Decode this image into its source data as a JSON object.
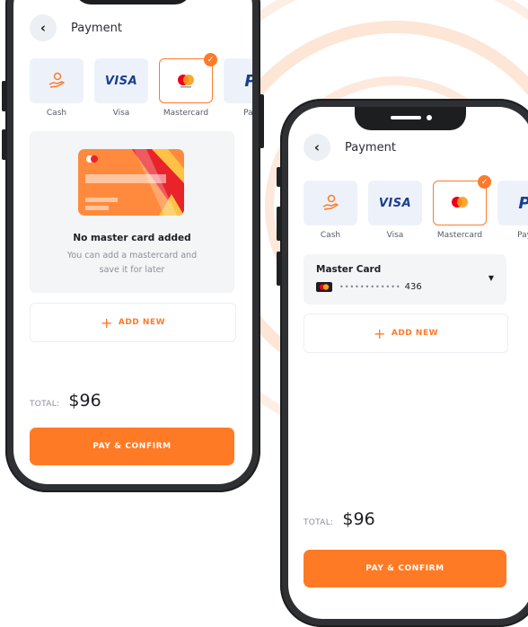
{
  "colors": {
    "accent": "#ff7a24",
    "tile_bg": "#edf2fa",
    "frame": "#2f3033"
  },
  "left_screen": {
    "header": {
      "back_icon": "chevron-left-icon",
      "back_glyph": "‹",
      "title": "Payment"
    },
    "methods": [
      {
        "label": "Cash",
        "icon": "cash-hand-icon",
        "selected": false
      },
      {
        "label": "Visa",
        "icon": "visa-logo",
        "logo_text": "VISA",
        "selected": false
      },
      {
        "label": "Mastercard",
        "icon": "mastercard-logo",
        "selected": true
      },
      {
        "label": "Pay",
        "icon": "paypal-logo",
        "logo_text": "P",
        "selected": false
      }
    ],
    "empty_state": {
      "title": "No master card added",
      "line1": "You can add a mastercard and",
      "line2": "save it for later"
    },
    "add_new": "ADD NEW",
    "total_label": "TOTAL:",
    "total_value": "$96",
    "pay_button": "PAY & CONFIRM"
  },
  "right_screen": {
    "header": {
      "back_icon": "chevron-left-icon",
      "back_glyph": "‹",
      "title": "Payment"
    },
    "methods": [
      {
        "label": "Cash",
        "icon": "cash-hand-icon",
        "selected": false
      },
      {
        "label": "Visa",
        "icon": "visa-logo",
        "logo_text": "VISA",
        "selected": false
      },
      {
        "label": "Mastercard",
        "icon": "mastercard-logo",
        "selected": true
      },
      {
        "label": "Pay",
        "icon": "paypal-logo",
        "logo_text": "P",
        "selected": false
      }
    ],
    "saved_card": {
      "name": "Master Card",
      "masked": "••••••••••••",
      "last_digits": "436",
      "dropdown_icon": "caret-down-icon",
      "caret_glyph": "▼"
    },
    "add_new": "ADD NEW",
    "total_label": "TOTAL:",
    "total_value": "$96",
    "pay_button": "PAY & CONFIRM"
  }
}
